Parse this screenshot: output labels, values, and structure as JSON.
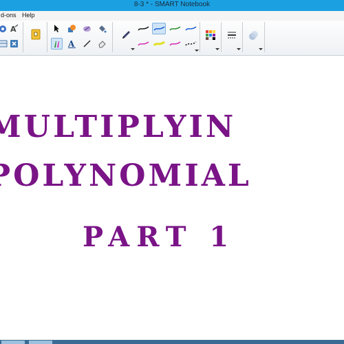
{
  "window": {
    "title": "8-3 * - SMART Notebook"
  },
  "menu": {
    "items": [
      "d-ons",
      "Help"
    ]
  },
  "toolbar": {
    "pen_colors": [
      "#1a1a1a",
      "#2b8f2b",
      "#1a5fd6",
      "#d62ab4",
      "#e0e020",
      "#2a2a2a"
    ],
    "palette_colors": [
      "#e53935",
      "#ff9800",
      "#fdd835",
      "#43a047",
      "#1e88e5",
      "#8e24aa",
      "#6d4c41",
      "#ffffff",
      "#000000"
    ],
    "accent": "#cfe4f7"
  },
  "slide": {
    "line1": "Multiplyin",
    "line2": "Polynomial",
    "line3": "Part 1",
    "text_color": "#7a1487"
  },
  "taskbar": {
    "color": "#3a6b94"
  }
}
